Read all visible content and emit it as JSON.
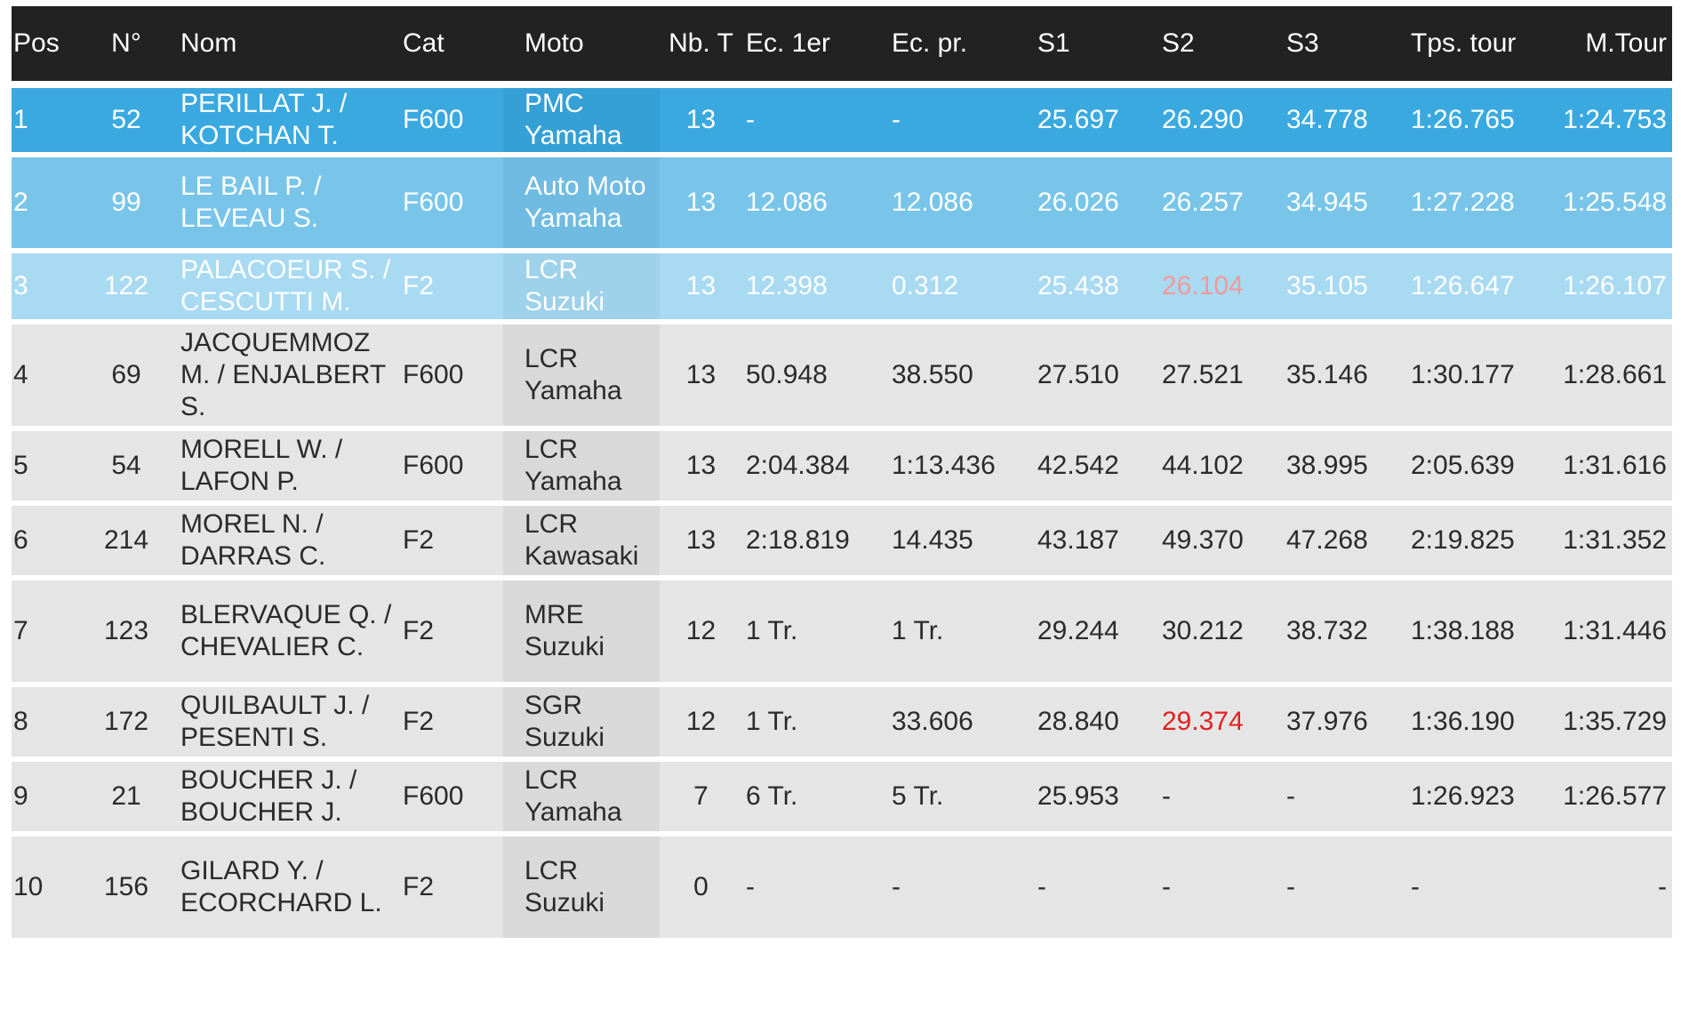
{
  "columns": {
    "pos": "Pos",
    "num": "N°",
    "nom": "Nom",
    "cat": "Cat",
    "moto": "Moto",
    "nbt": "Nb. T",
    "ec1": "Ec. 1er",
    "ecp": "Ec. pr.",
    "s1": "S1",
    "s2": "S2",
    "s3": "S3",
    "tps": "Tps. tour",
    "mt": "M.Tour"
  },
  "rows": [
    {
      "pos": "1",
      "num": "52",
      "nom": "PERILLAT J. / KOTCHAN T.",
      "cat": "F600",
      "moto": "PMC Yamaha",
      "nbt": "13",
      "ec1": "-",
      "ecp": "-",
      "s1": "25.697",
      "s2": "26.290",
      "s3": "34.778",
      "tps": "1:26.765",
      "mt": "1:24.753"
    },
    {
      "pos": "2",
      "num": "99",
      "nom": "LE BAIL P. / LEVEAU S.",
      "cat": "F600",
      "moto": "Auto Moto Yamaha",
      "nbt": "13",
      "ec1": "12.086",
      "ecp": "12.086",
      "s1": "26.026",
      "s2": "26.257",
      "s3": "34.945",
      "tps": "1:27.228",
      "mt": "1:25.548"
    },
    {
      "pos": "3",
      "num": "122",
      "nom": "PALACOEUR S. / CESCUTTI M.",
      "cat": "F2",
      "moto": "LCR Suzuki",
      "nbt": "13",
      "ec1": "12.398",
      "ecp": "0.312",
      "s1": "25.438",
      "s2": "26.104",
      "s3": "35.105",
      "tps": "1:26.647",
      "mt": "1:26.107"
    },
    {
      "pos": "4",
      "num": "69",
      "nom": "JACQUEMMOZ M. / ENJALBERT S.",
      "cat": "F600",
      "moto": "LCR Yamaha",
      "nbt": "13",
      "ec1": "50.948",
      "ecp": "38.550",
      "s1": "27.510",
      "s2": "27.521",
      "s3": "35.146",
      "tps": "1:30.177",
      "mt": "1:28.661"
    },
    {
      "pos": "5",
      "num": "54",
      "nom": "MORELL W. / LAFON P.",
      "cat": "F600",
      "moto": "LCR Yamaha",
      "nbt": "13",
      "ec1": "2:04.384",
      "ecp": "1:13.436",
      "s1": "42.542",
      "s2": "44.102",
      "s3": "38.995",
      "tps": "2:05.639",
      "mt": "1:31.616"
    },
    {
      "pos": "6",
      "num": "214",
      "nom": "MOREL N. / DARRAS C.",
      "cat": "F2",
      "moto": "LCR Kawasaki",
      "nbt": "13",
      "ec1": "2:18.819",
      "ecp": "14.435",
      "s1": "43.187",
      "s2": "49.370",
      "s3": "47.268",
      "tps": "2:19.825",
      "mt": "1:31.352"
    },
    {
      "pos": "7",
      "num": "123",
      "nom": "BLERVAQUE Q. / CHEVALIER C.",
      "cat": "F2",
      "moto": "MRE Suzuki",
      "nbt": "12",
      "ec1": "1 Tr.",
      "ecp": "1 Tr.",
      "s1": "29.244",
      "s2": "30.212",
      "s3": "38.732",
      "tps": "1:38.188",
      "mt": "1:31.446"
    },
    {
      "pos": "8",
      "num": "172",
      "nom": "QUILBAULT J. / PESENTI S.",
      "cat": "F2",
      "moto": "SGR Suzuki",
      "nbt": "12",
      "ec1": "1 Tr.",
      "ecp": "33.606",
      "s1": "28.840",
      "s2": "29.374",
      "s3": "37.976",
      "tps": "1:36.190",
      "mt": "1:35.729"
    },
    {
      "pos": "9",
      "num": "21",
      "nom": "BOUCHER J. / BOUCHER J.",
      "cat": "F600",
      "moto": "LCR Yamaha",
      "nbt": "7",
      "ec1": "6 Tr.",
      "ecp": "5 Tr.",
      "s1": "25.953",
      "s2": "-",
      "s3": "-",
      "tps": "1:26.923",
      "mt": "1:26.577"
    },
    {
      "pos": "10",
      "num": "156",
      "nom": "GILARD Y. / ECORCHARD L.",
      "cat": "F2",
      "moto": "LCR Suzuki",
      "nbt": "0",
      "ec1": "-",
      "ecp": "-",
      "s1": "-",
      "s2": "-",
      "s3": "-",
      "tps": "-",
      "mt": "-"
    }
  ],
  "colors": {
    "header_bg": "#222222",
    "podium_1": "#3aa9e0",
    "podium_2": "#79c5ea",
    "podium_3": "#a8daf2",
    "row_bg": "#e5e5e5",
    "moto_cell_bg": "#d9d9d9",
    "best_sector": "#e32020"
  }
}
